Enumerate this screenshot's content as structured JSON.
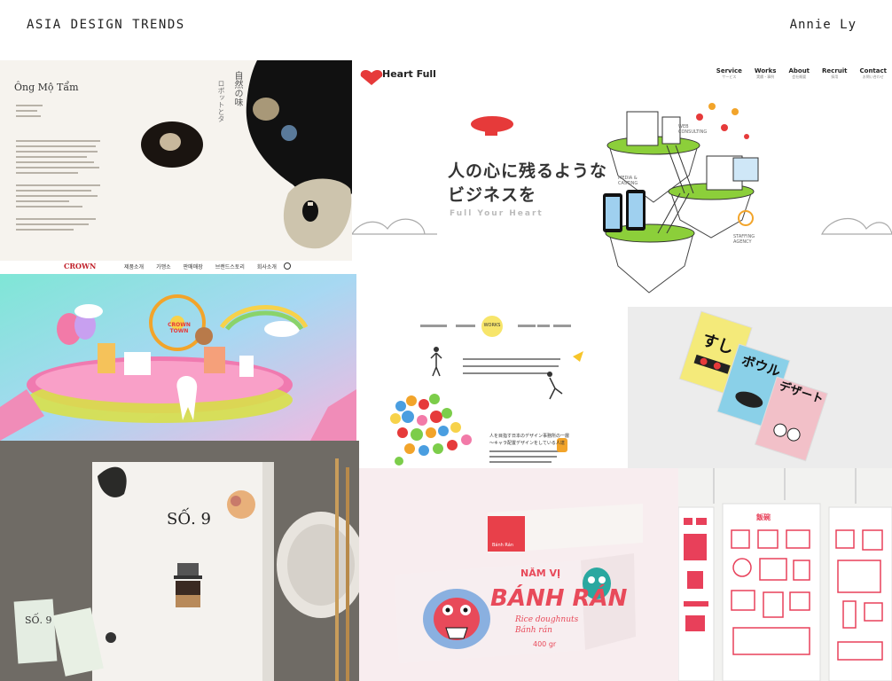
{
  "header": {
    "title": "ASIA DESIGN TRENDS",
    "author": "Annie Ly"
  },
  "tile1": {
    "logo": "Ông Mộ Tẩm",
    "jp_a": "自然の味",
    "jp_b": "ロボットとタ"
  },
  "tile2": {
    "brand": "Heart Full",
    "nav": [
      {
        "en": "Service",
        "jp": "サービス"
      },
      {
        "en": "Works",
        "jp": "実績・事例"
      },
      {
        "en": "About",
        "jp": "会社概要"
      },
      {
        "en": "Recruit",
        "jp": "採用"
      },
      {
        "en": "Contact",
        "jp": "お問い合わせ"
      }
    ],
    "headline_a": "人の心に残るような",
    "headline_b": "ビジネスを",
    "tagline": "Full Your Heart",
    "labels": [
      "WEB CONSULTING",
      "MEDIA & CASTING",
      "STAFFING AGENCY"
    ]
  },
  "tile3": {
    "brand": "CROWN",
    "town": "CROWN TOWN",
    "nav": [
      "제품소개",
      "가맹소",
      "판매매장",
      "브랜드스토리",
      "회사소개"
    ]
  },
  "tile4": {
    "badge": "WORKS",
    "body_a": "人を目指す日本のデザイン事務所の一層",
    "body_b": "〜キャラ配置デザインをしている人達"
  },
  "tile5": {
    "book1": "すし",
    "book2": "ボウル",
    "book3": "デザート"
  },
  "tile6": {
    "number": "SỐ. 9",
    "card_number": "SỐ. 9"
  },
  "tile7": {
    "small_box": "Bánh Rán",
    "brand": "NĂM VỊ",
    "product": "BÁNH RÁN",
    "sub": "Rice doughnuts",
    "sub2": "Bánh rán",
    "weight": "400 gr"
  },
  "tile8": {
    "poster": "飯碗"
  },
  "colors": {
    "heart_red": "#e63a3a",
    "crown_pink": "#f27aa8",
    "sky_teal": "#7fe6d6",
    "poster_red": "#e8405a"
  }
}
